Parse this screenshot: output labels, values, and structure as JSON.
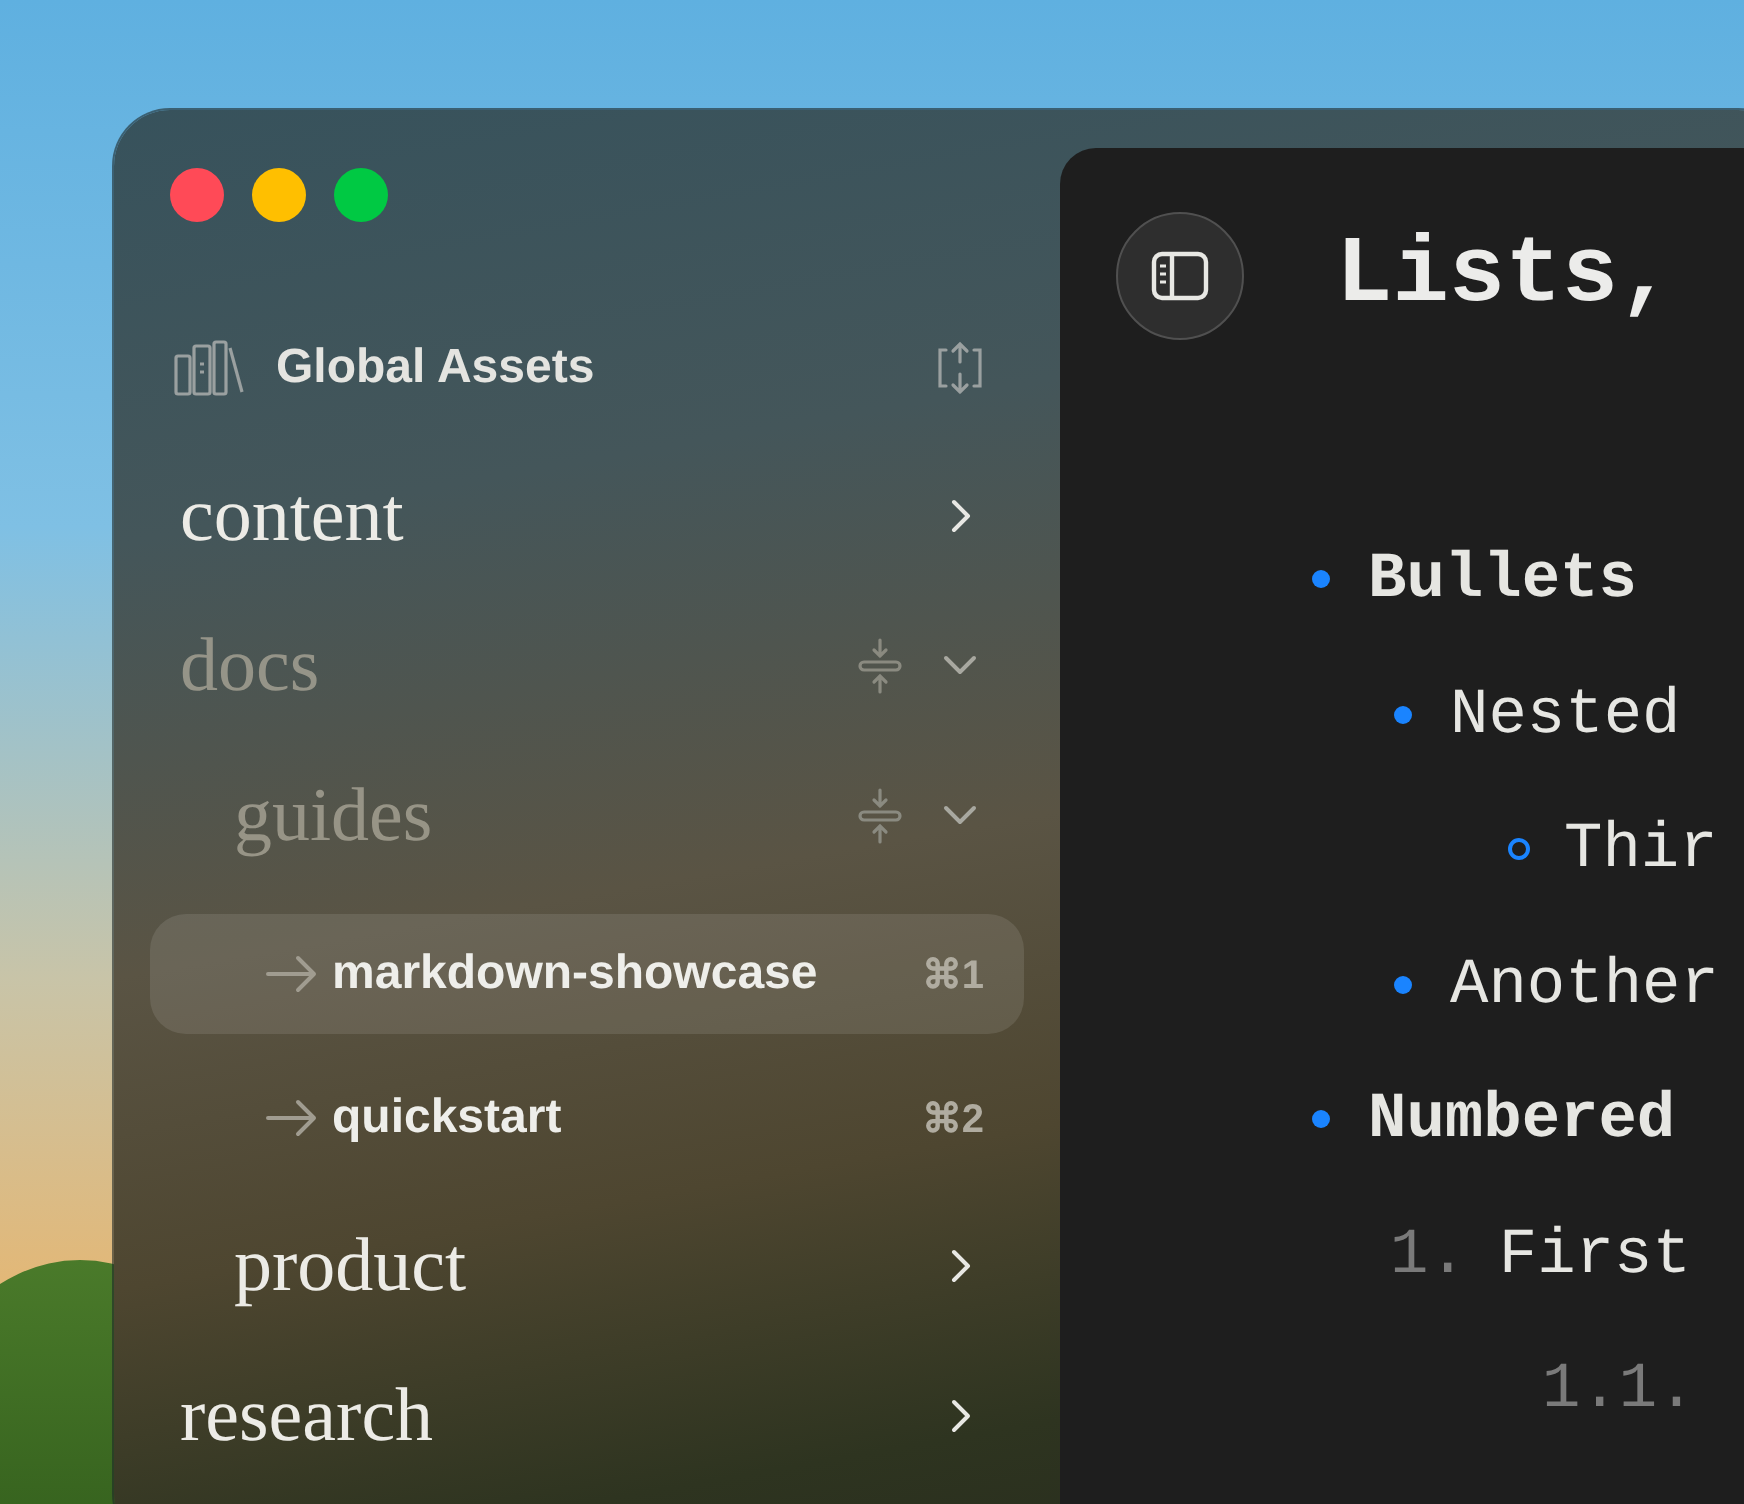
{
  "sidebar": {
    "workspace": {
      "name": "Global Assets"
    },
    "tree": [
      {
        "kind": "folder",
        "name": "content",
        "expanded": false
      },
      {
        "kind": "folder",
        "name": "docs",
        "expanded": true,
        "children": [
          {
            "kind": "folder",
            "name": "guides",
            "expanded": true,
            "children": [
              {
                "kind": "page",
                "name": "markdown-showcase",
                "shortcut": "⌘1",
                "selected": true
              },
              {
                "kind": "page",
                "name": "quickstart",
                "shortcut": "⌘2",
                "selected": false
              }
            ]
          },
          {
            "kind": "folder",
            "name": "product",
            "expanded": false
          }
        ]
      },
      {
        "kind": "folder",
        "name": "research",
        "expanded": false
      }
    ]
  },
  "editor": {
    "title": "Lists,",
    "list": [
      {
        "kind": "bullet",
        "text": "Bullets",
        "children": [
          {
            "kind": "bullet",
            "text": "Nested",
            "children": [
              {
                "kind": "circle",
                "text": "Thir"
              }
            ]
          },
          {
            "kind": "bullet",
            "text": "Another"
          }
        ]
      },
      {
        "kind": "bullet",
        "text": "Numbered",
        "children": [
          {
            "kind": "number",
            "number": "1.",
            "text": "First",
            "children": [
              {
                "kind": "number",
                "number": "1.1."
              }
            ]
          }
        ]
      }
    ]
  }
}
